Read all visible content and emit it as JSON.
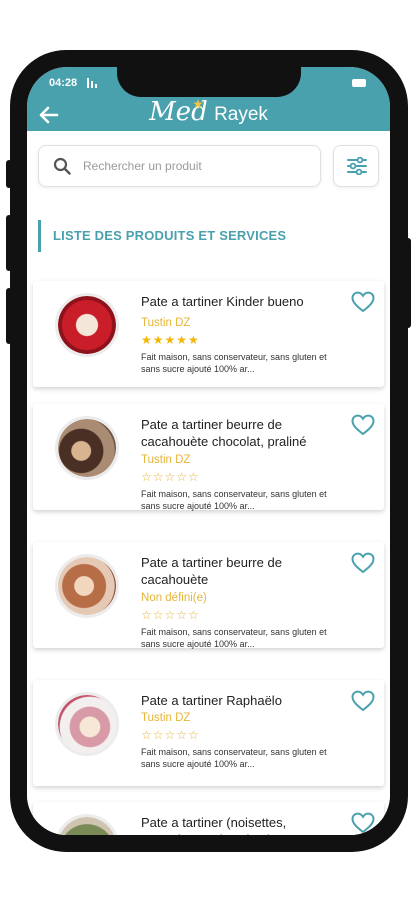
{
  "status": {
    "time": "04:28"
  },
  "header": {
    "logo_main": "Med",
    "logo_brand": "Rayek"
  },
  "search": {
    "placeholder": "Rechercher un produit"
  },
  "section": {
    "title": "LISTE DES PRODUITS ET SERVICES"
  },
  "products": [
    {
      "name": "Pate a tartiner Kinder bueno",
      "seller": "Tustin DZ",
      "stars": "★★★★★",
      "rating": 5,
      "description": "Fait maison, sans conservateur, sans gluten et sans sucre ajouté 100% ar..."
    },
    {
      "name": "Pate a tartiner beurre de cacahouète chocolat, praliné",
      "seller": "Tustin DZ",
      "stars": "☆☆☆☆☆",
      "rating": 0,
      "description": "Fait maison, sans conservateur, sans gluten et sans sucre ajouté 100% ar..."
    },
    {
      "name": "Pate a tartiner beurre de cacahouète",
      "seller": "Non défini(e)",
      "stars": "☆☆☆☆☆",
      "rating": 0,
      "description": "Fait maison, sans conservateur, sans gluten et sans sucre ajouté 100% ar..."
    },
    {
      "name": "Pate a tartiner Raphaëlo",
      "seller": "Tustin DZ",
      "stars": "☆☆☆☆☆",
      "rating": 0,
      "description": "Fait maison, sans conservateur, sans gluten et sans sucre ajouté 100% ar..."
    },
    {
      "name": "Pate a tartiner (noisettes, amandes et pistaches)",
      "seller": "",
      "stars": "",
      "rating": 0,
      "description": ""
    }
  ],
  "colors": {
    "primary": "#4aa1ae",
    "star": "#e6b53a",
    "text": "#222222"
  },
  "icons": {
    "back": "arrow-left-icon",
    "search": "search-icon",
    "filter": "sliders-icon",
    "favorite": "heart-outline-icon"
  }
}
